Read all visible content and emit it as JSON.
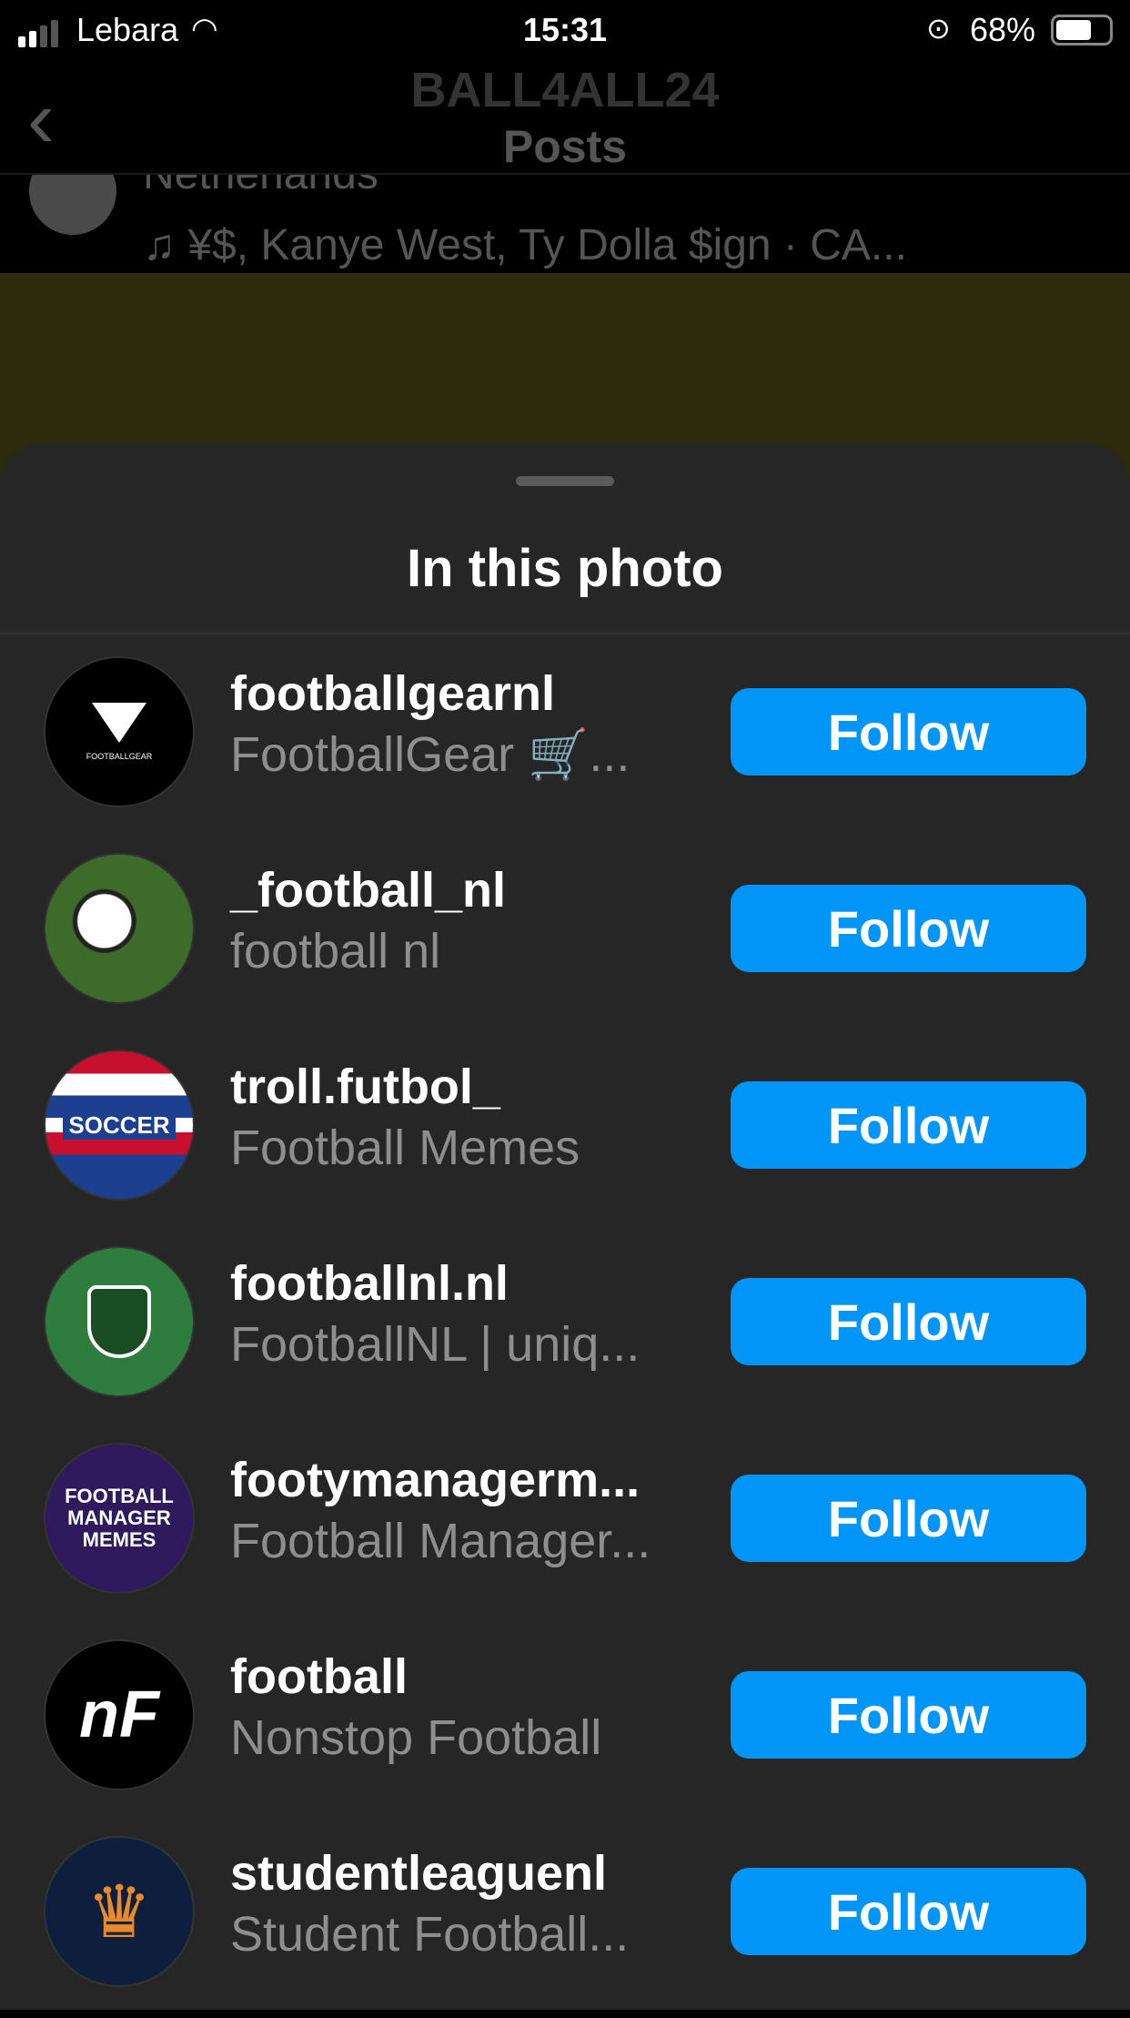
{
  "status_bar": {
    "carrier": "Lebara",
    "time": "15:31",
    "battery": "68%",
    "battery_level": 0.68
  },
  "nav": {
    "account": "BALL4ALL24",
    "title": "Posts"
  },
  "background_post": {
    "location": "Netherlands",
    "music": "♫ ¥$, Kanye West, Ty Dolla $ign · CA..."
  },
  "sheet": {
    "title": "In this photo"
  },
  "accounts": [
    {
      "username": "footballgearnl",
      "subtitle": "FootballGear 🛒...",
      "avatar_text": "FOOTBALLGEAR",
      "follow": "Follow"
    },
    {
      "username": "_football_nl",
      "subtitle": "football nl",
      "follow": "Follow"
    },
    {
      "username": "troll.futbol_",
      "subtitle": "Football Memes",
      "avatar_text": "SOCCER",
      "follow": "Follow"
    },
    {
      "username": "footballnl.nl",
      "subtitle": "FootballNL | uniq...",
      "follow": "Follow"
    },
    {
      "username": "footymanagerm...",
      "subtitle": "Football Manager...",
      "avatar_text": "FOOTBALL MANAGER MEMES",
      "follow": "Follow"
    },
    {
      "username": "football",
      "subtitle": "Nonstop Football",
      "avatar_text": "nF",
      "follow": "Follow"
    },
    {
      "username": "studentleaguenl",
      "subtitle": "Student Football...",
      "follow": "Follow"
    }
  ]
}
